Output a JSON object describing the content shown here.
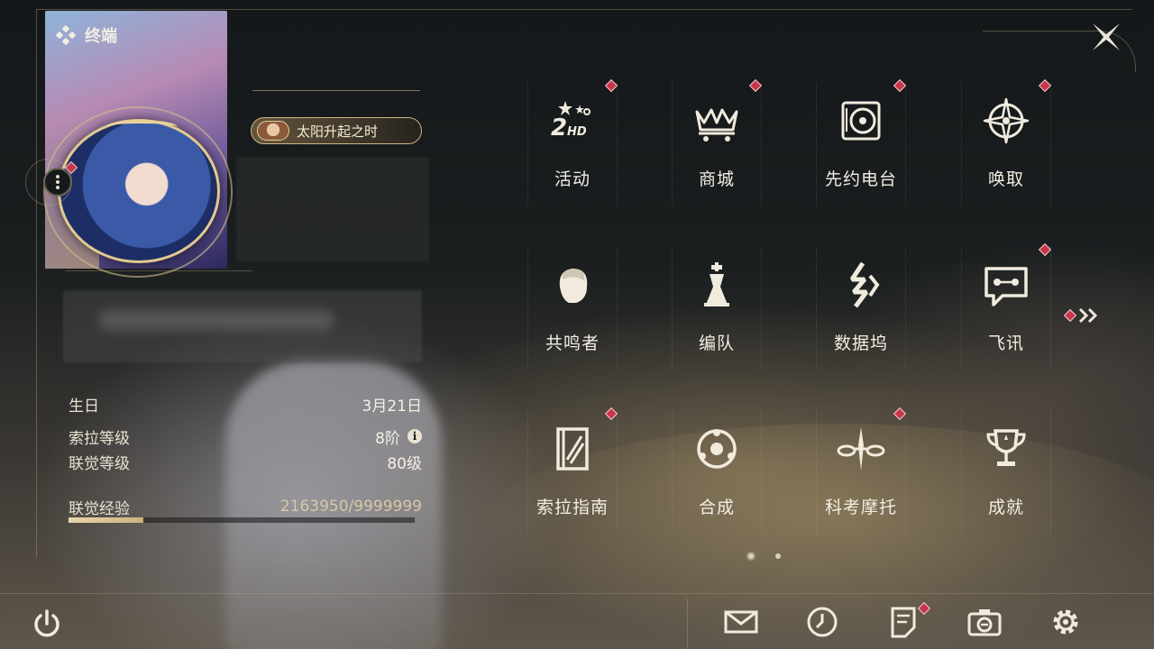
{
  "header": {
    "title": "终端"
  },
  "profile": {
    "title_badge": "太阳升起之时"
  },
  "stats": [
    {
      "key": "生日",
      "value": "3月21日"
    },
    {
      "key": "索拉等级",
      "value": "8阶"
    },
    {
      "key": "联觉等级",
      "value": "80级"
    }
  ],
  "experience": {
    "key": "联觉经验",
    "value": "2163950/9999999",
    "progress": 0.2164
  },
  "menu": [
    {
      "label": "活动",
      "icon": "event-2hd-icon",
      "badge": true
    },
    {
      "label": "商城",
      "icon": "shop-cart-crown-icon",
      "badge": true
    },
    {
      "label": "先约电台",
      "icon": "radio-record-icon",
      "badge": true
    },
    {
      "label": "唤取",
      "icon": "compass-star-icon",
      "badge": true
    },
    {
      "label": "共鸣者",
      "icon": "resonator-head-icon",
      "badge": false
    },
    {
      "label": "编队",
      "icon": "chess-team-icon",
      "badge": false
    },
    {
      "label": "数据坞",
      "icon": "data-dock-icon",
      "badge": false
    },
    {
      "label": "飞讯",
      "icon": "message-bubble-icon",
      "badge": true
    },
    {
      "label": "索拉指南",
      "icon": "guide-book-icon",
      "badge": true
    },
    {
      "label": "合成",
      "icon": "synthesis-orb-icon",
      "badge": false
    },
    {
      "label": "科考摩托",
      "icon": "motorbike-icon",
      "badge": true
    },
    {
      "label": "成就",
      "icon": "trophy-icon",
      "badge": false
    }
  ],
  "pagination": {
    "current_page": 1,
    "total_pages": 2
  },
  "colors": {
    "accent_gold": "#d8c9a4",
    "badge_red": "#c7364a",
    "text": "#f2eee3"
  }
}
